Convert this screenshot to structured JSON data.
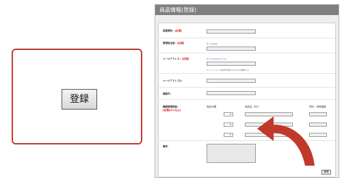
{
  "callout": {
    "button_label": "登録"
  },
  "form": {
    "title": "商品情報(登録)",
    "fields": [
      {
        "label": "設置場所：",
        "required": "[必須]"
      },
      {
        "label": "管理担当者：",
        "required": "[必須]",
        "hint": "例）山田太郎"
      },
      {
        "label": "メールアドレス：",
        "required": "[必須]",
        "hint": "例）mail@gelmani.info",
        "note": "※1 メールアドレスは検索時登録されるため大変重要です。"
      },
      {
        "label": "メールアドレス2：",
        "required": ""
      },
      {
        "label": "連絡先：",
        "required": ""
      }
    ],
    "product_section": {
      "label": "機器管理物品：",
      "required": "[必須](1つ以上)",
      "col_category": "商品分類",
      "col_name": "商品名（NO）",
      "col_qty": "資料・消費価格"
    },
    "remarks_label": "備考：",
    "submit_label": "登録"
  }
}
